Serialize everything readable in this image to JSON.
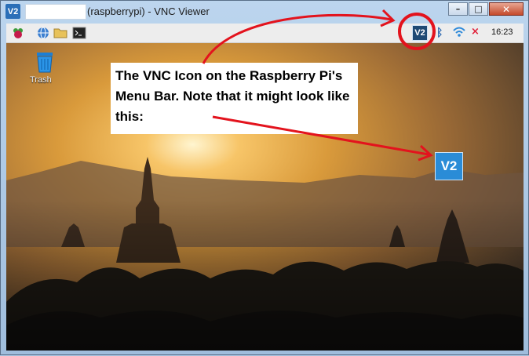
{
  "window": {
    "title": "(raspberrypi) - VNC Viewer",
    "app_icon": "V2",
    "controls": {
      "minimize": "–",
      "maximize": "□",
      "close": "✕"
    }
  },
  "menubar": {
    "tray_vnc_label": "V2",
    "clock": "16:23",
    "icons": [
      "raspberry-icon",
      "globe-icon",
      "folder-icon",
      "terminal-icon",
      "vnc-icon",
      "bluetooth-icon",
      "wifi-icon",
      "volume-icon"
    ]
  },
  "desktop": {
    "trash_label": "Trash"
  },
  "callout": {
    "text": "The VNC Icon on the Raspberry Pi's Menu Bar.  Note that it might look like this:"
  },
  "big_vnc_label": "V2",
  "colors": {
    "annotation_red": "#e3131d",
    "vnc_blue": "#2a8cd7",
    "tray_dark": "#1e4a74"
  }
}
